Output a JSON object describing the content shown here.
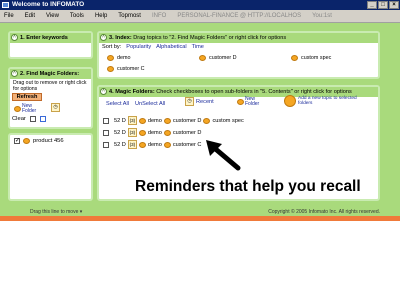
{
  "window": {
    "title": "Welcome to INFOMATO"
  },
  "menu": {
    "items": [
      "File",
      "Edit",
      "View",
      "Tools",
      "Help",
      "Topmost"
    ],
    "info": "INFO",
    "url": "PERSONAL-FINANCE @ HTTP://LOCALHOS",
    "user": "You:1st"
  },
  "panel1": {
    "title": "1. Enter keywords"
  },
  "panel2": {
    "title": "2. Find Magic Folders:",
    "hint": "Drag out to remove or right click for options",
    "refresh": "Refresh",
    "new_folder": "New Folder",
    "clear": "Clear"
  },
  "panel_product": {
    "item": "product 456"
  },
  "panel3": {
    "title": "3. Index:",
    "subtitle": "Drag topics to \"2. Find Magic Folders\" or right click for options",
    "sort_by": "Sort by:",
    "sort_options": [
      "Popularity",
      "Alphabetical",
      "Time"
    ],
    "items": [
      "demo",
      "customer D",
      "custom spec",
      "customer C"
    ]
  },
  "panel4": {
    "title": "4. Magic Folders:",
    "subtitle": "Check checkboxes to open sub-folders in \"5. Contents\" or right click for options",
    "select_all": "Select All",
    "unselect_all": "UnSelect All",
    "recent": "Recent",
    "new_folder": "New Folder",
    "add_topic": "Add a new topic to selected folders",
    "rows": [
      {
        "date": "52 D",
        "count": "(3)",
        "tags": [
          "demo",
          "customer D",
          "custom spec"
        ]
      },
      {
        "date": "52 D",
        "count": "(3)",
        "tags": [
          "demo",
          "customer D"
        ]
      },
      {
        "date": "52 D",
        "count": "(3)",
        "tags": [
          "demo",
          "customer C"
        ]
      }
    ]
  },
  "footer": {
    "drag": "Drag this line to move",
    "copyright": "Copyright © 2005 Infomato Inc. All rights reserved."
  },
  "caption": "Reminders that help you recall"
}
